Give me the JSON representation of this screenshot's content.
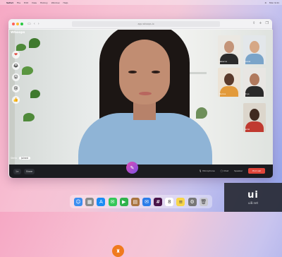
{
  "menubar": {
    "app": "Safari",
    "items": [
      "File",
      "Edit",
      "View",
      "History",
      "Window",
      "Help"
    ],
    "clock": "Mon 9:41"
  },
  "browser": {
    "url": "app.whoops.io"
  },
  "app": {
    "logo": "Whoops"
  },
  "reactions": [
    "❤",
    "😂",
    "😮",
    "😢",
    "👍"
  ],
  "participants": [
    {
      "name": "Rebecca",
      "face": "#c49478",
      "body": "#2b2b2b",
      "bg": "#ebe8e2"
    },
    {
      "name": "Daniel",
      "face": "#d6a886",
      "body": "#7aa4c9",
      "bg": "#e3e7ea"
    },
    {
      "name": "Marcus",
      "face": "#5a3a2a",
      "body": "#e29a3a",
      "bg": "#ece3d6"
    },
    {
      "name": "Priya",
      "face": "#b07a5e",
      "body": "#2a2a2a",
      "bg": "#e8e6e3"
    },
    {
      "name": "Jamal",
      "face": "#3f2a20",
      "body": "#c03a30",
      "bg": "#dcd6cc"
    }
  ],
  "name_tag": {
    "label": "Stella",
    "status": "Joined"
  },
  "bottom_bar": {
    "left_button": "1×",
    "left_button2": "Share",
    "mic": "Microphone",
    "chat": "Chat",
    "more": "Speaker",
    "end": "End call"
  },
  "dock_icons": [
    {
      "name": "finder",
      "color": "#3b8ef0",
      "glyph": "☺"
    },
    {
      "name": "launchpad",
      "color": "#8a8a8a",
      "glyph": "▦"
    },
    {
      "name": "appstore",
      "color": "#1b8cf5",
      "glyph": "A"
    },
    {
      "name": "messages",
      "color": "#34c759",
      "glyph": "✉"
    },
    {
      "name": "facetime",
      "color": "#2fb24c",
      "glyph": "▶"
    },
    {
      "name": "notes-brown",
      "color": "#a9743f",
      "glyph": "▤"
    },
    {
      "name": "mail",
      "color": "#2b7de9",
      "glyph": "✉"
    },
    {
      "name": "slack",
      "color": "#4a154b",
      "glyph": "#"
    },
    {
      "name": "calendar",
      "color": "#ffffff",
      "glyph": "8"
    },
    {
      "name": "notes",
      "color": "#f7d54a",
      "glyph": "≡"
    },
    {
      "name": "settings",
      "color": "#777777",
      "glyph": "⚙"
    },
    {
      "name": "trash",
      "color": "#c9c9cf",
      "glyph": "🗑"
    }
  ],
  "watermark": {
    "big": "ui",
    "small": "ui8.net"
  }
}
